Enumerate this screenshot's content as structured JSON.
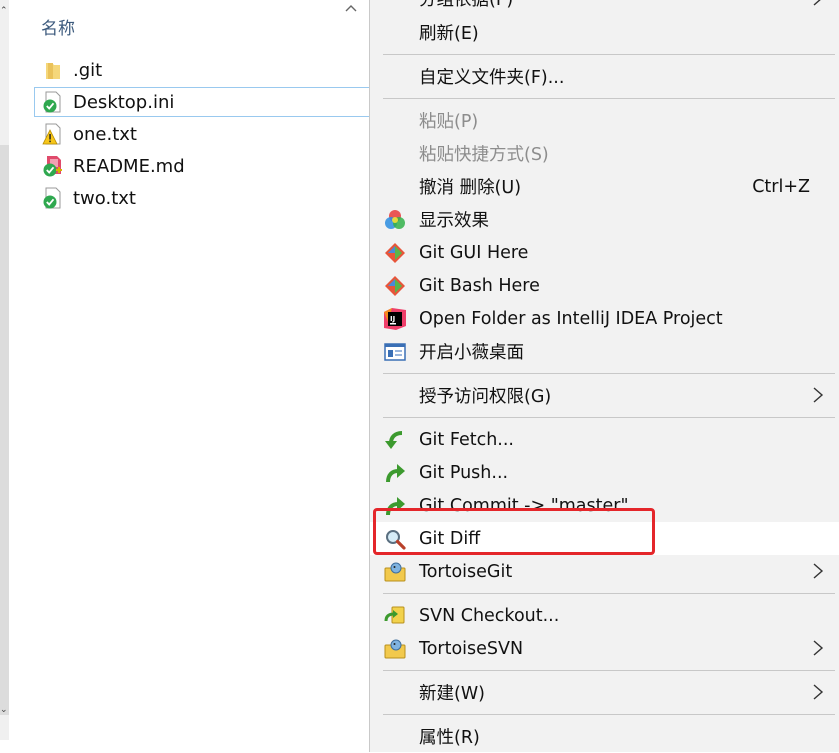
{
  "explorer": {
    "column_header": "名称",
    "files": [
      {
        "name": ".git",
        "icon": "folder-icon"
      },
      {
        "name": "Desktop.ini",
        "icon": "git-clean-file-icon"
      },
      {
        "name": "one.txt",
        "icon": "git-modified-warning-icon"
      },
      {
        "name": "README.md",
        "icon": "git-added-file-icon"
      },
      {
        "name": "two.txt",
        "icon": "git-clean-file-icon"
      }
    ]
  },
  "menu": {
    "items": {
      "group_by": "分组依据(P)",
      "refresh": "刷新(E)",
      "customize_folder": "自定义文件夹(F)...",
      "paste": "粘贴(P)",
      "paste_shortcut": "粘贴快捷方式(S)",
      "undo_delete": "撤消 删除(U)",
      "undo_accel": "Ctrl+Z",
      "display_effects": "显示效果",
      "git_gui": "Git GUI Here",
      "git_bash": "Git Bash Here",
      "intellij": "Open Folder as IntelliJ IDEA Project",
      "xiaowei": "开启小薇桌面",
      "grant_access": "授予访问权限(G)",
      "git_fetch": "Git Fetch...",
      "git_push": "Git Push...",
      "git_commit": "Git Commit -> \"master\"...",
      "git_diff": "Git Diff",
      "tortoisegit": "TortoiseGit",
      "svn_checkout": "SVN Checkout...",
      "tortoisesvn": "TortoiseSVN",
      "new": "新建(W)",
      "properties": "属性(R)"
    }
  },
  "colors": {
    "menu_bg": "#f2f2f2",
    "highlight_red": "#e4262a",
    "header_blue": "#3c5a7d",
    "selection_border": "#99c9ef"
  }
}
